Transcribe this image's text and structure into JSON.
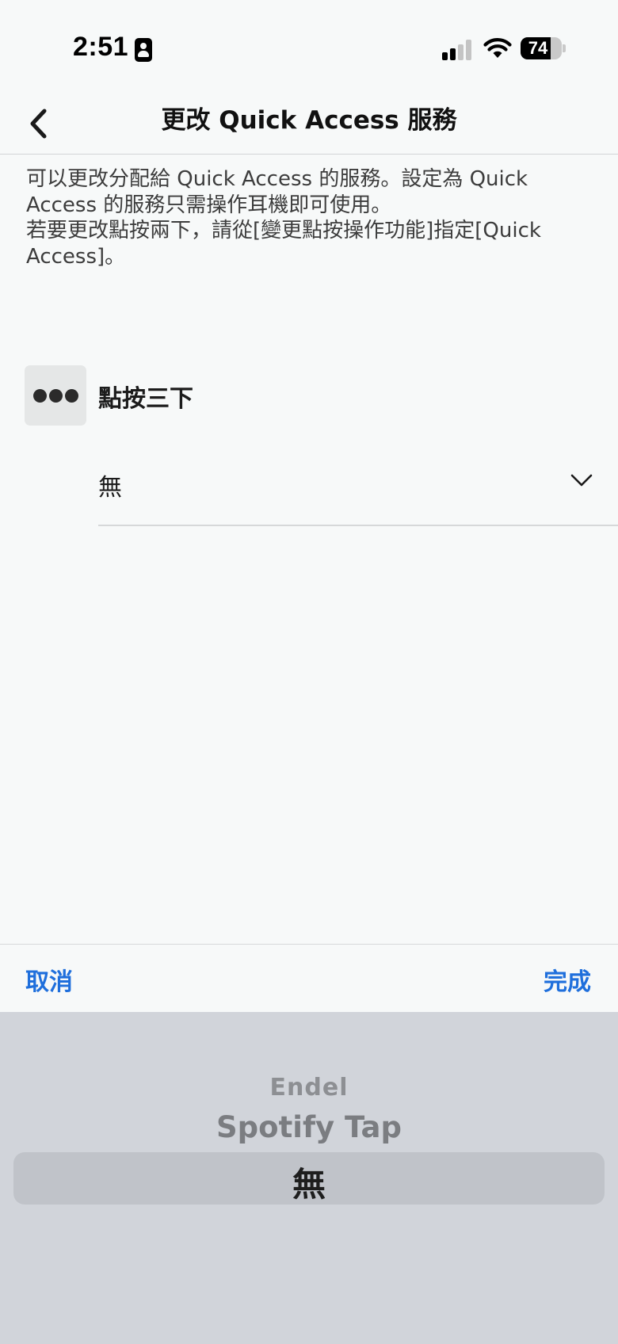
{
  "status_bar": {
    "time": "2:51",
    "battery_percent": "74",
    "battery_level": 0.74,
    "signal_bars_active": 2,
    "signal_bars_total": 4
  },
  "nav": {
    "title": "更改 Quick Access 服務"
  },
  "description": {
    "line1": "可以更改分配給 Quick Access 的服務。設定為 Quick Access 的服務只需操作耳機即可使用。",
    "line2": "若要更改點按兩下，請從[變更點按操作功能]指定[Quick Access]。"
  },
  "gesture": {
    "label": "點按三下",
    "selected_value": "無"
  },
  "picker_toolbar": {
    "cancel_label": "取消",
    "done_label": "完成"
  },
  "picker": {
    "options": [
      "Endel",
      "Spotify Tap",
      "無"
    ],
    "selected_index": 2
  },
  "colors": {
    "accent": "#1f6fdc",
    "background": "#f7f9f9",
    "picker_background": "#d1d4da"
  }
}
